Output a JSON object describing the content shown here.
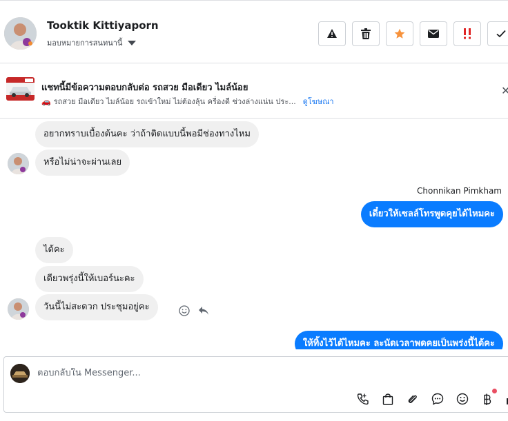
{
  "contact": {
    "name": "Tooktik Kittiyaporn",
    "assign_label": "มอบหมายการสนทนานี้"
  },
  "toolbar": {
    "icons": [
      "warning-icon",
      "trash-icon",
      "star-icon",
      "mail-icon",
      "important-icon",
      "check-icon"
    ],
    "star_color": "#f7923b",
    "important_color": "#e02424"
  },
  "ad": {
    "title": "แชทนี้มีข้อความตอบกลับต่อ รถสวย มือเดียว ไมล์น้อย",
    "description": "รถสวย มือเดียว ไมล์น้อย รถเข้าใหม่ ไม่ต้องลุ้น ครื่องดี ช่วงล่างแน่น ประ...",
    "link_label": "ดูโฆษณา",
    "car_emoji": "🚗"
  },
  "messages": {
    "m1": "อยากทราบเบื้องต้นคะ ว่าถ้าติดแบบนี้พอมีช่องทางไหม",
    "m2": "หรือไม่น่าจะผ่านเลย",
    "sender": "Chonnikan Pimkham",
    "m3": "เดี๋ยวให้เซลล์โทรพูดคุยได้ไหมคะ",
    "m4": "ได้คะ",
    "m5": "เดียวพรุ่งนี้ให้เบอร์นะคะ",
    "m6": "วันนี้ไม่สะดวก ประชุมอยู่คะ",
    "m7": "ให้ทิ้งไว้ได้ไหมคะ ละนัดเวลาพดคยเป็นพร่งนี้ได้คะ"
  },
  "reply": {
    "placeholder": "ตอบกลับใน Messenger..."
  },
  "colors": {
    "outgoing_bubble": "#0a7cff",
    "incoming_bubble": "#f0f0f0",
    "link": "#1877f2"
  }
}
